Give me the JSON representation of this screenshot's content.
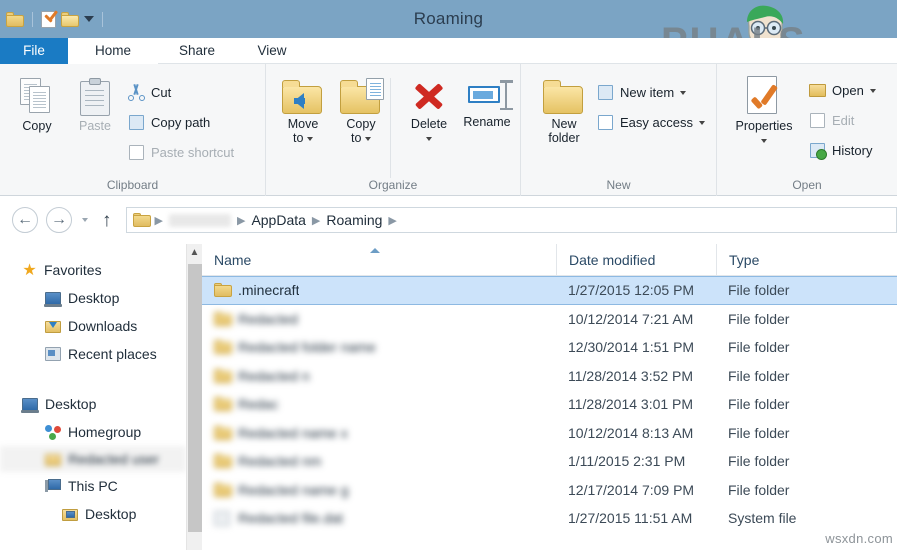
{
  "window": {
    "title": "Roaming",
    "quick_access": [
      "folder-icon",
      "properties-icon",
      "new-folder-icon",
      "customize-caret-icon"
    ]
  },
  "tabs": [
    {
      "label": "File",
      "state": "file"
    },
    {
      "label": "Home",
      "state": "active"
    },
    {
      "label": "Share",
      "state": "normal"
    },
    {
      "label": "View",
      "state": "normal"
    }
  ],
  "ribbon": {
    "groups": [
      {
        "name": "Clipboard",
        "label": "Clipboard",
        "big_buttons": [
          {
            "label": "Copy",
            "icon": "copy-icon",
            "disabled": false
          },
          {
            "label": "Paste",
            "icon": "paste-icon",
            "disabled": true
          }
        ],
        "small_buttons": [
          {
            "label": "Cut",
            "icon": "scissors-icon",
            "disabled": false
          },
          {
            "label": "Copy path",
            "icon": "copy-path-icon",
            "disabled": false
          },
          {
            "label": "Paste shortcut",
            "icon": "paste-shortcut-icon",
            "disabled": true
          }
        ]
      },
      {
        "name": "Organize",
        "label": "Organize",
        "big_buttons": [
          {
            "label": "Move\nto",
            "label_line1": "Move",
            "label_line2": "to",
            "icon": "move-to-icon",
            "caret": true
          },
          {
            "label": "Copy\nto",
            "label_line1": "Copy",
            "label_line2": "to",
            "icon": "copy-to-icon",
            "caret": true
          },
          {
            "label": "Delete",
            "icon": "delete-icon",
            "caret": true
          },
          {
            "label": "Rename",
            "icon": "rename-icon",
            "caret": false
          }
        ]
      },
      {
        "name": "New",
        "label": "New",
        "big_buttons": [
          {
            "label_line1": "New",
            "label_line2": "folder",
            "icon": "new-folder-icon"
          }
        ],
        "small_buttons": [
          {
            "label": "New item",
            "icon": "new-item-icon",
            "caret": true
          },
          {
            "label": "Easy access",
            "icon": "easy-access-icon",
            "caret": true
          }
        ]
      },
      {
        "name": "Open",
        "label": "Open",
        "big_buttons": [
          {
            "label": "Properties",
            "icon": "properties-icon",
            "caret": true
          }
        ],
        "small_buttons": [
          {
            "label": "Open",
            "icon": "open-icon",
            "caret": true,
            "disabled": false
          },
          {
            "label": "Edit",
            "icon": "edit-icon",
            "caret": false,
            "disabled": true
          },
          {
            "label": "History",
            "icon": "history-icon",
            "caret": false,
            "disabled": false
          }
        ]
      }
    ]
  },
  "address_bar": {
    "back_icon": "back-arrow-icon",
    "forward_icon": "forward-arrow-icon",
    "recent_caret_icon": "history-dropdown-icon",
    "up_icon": "up-arrow-icon",
    "breadcrumbs": [
      {
        "label": "",
        "redacted": true,
        "width": 62
      },
      {
        "label": "AppData",
        "redacted": false
      },
      {
        "label": "Roaming",
        "redacted": false
      }
    ]
  },
  "nav_pane": {
    "items": [
      {
        "label": "Favorites",
        "icon": "star-icon",
        "level": 0,
        "blurred": false
      },
      {
        "label": "Desktop",
        "icon": "monitor-icon",
        "level": 1,
        "blurred": false
      },
      {
        "label": "Downloads",
        "icon": "downloads-folder-icon",
        "level": 1,
        "blurred": false
      },
      {
        "label": "Recent places",
        "icon": "recent-places-icon",
        "level": 1,
        "blurred": false
      },
      {
        "label": "",
        "icon": "spacer",
        "level": 0,
        "blurred": false,
        "spacer": true
      },
      {
        "label": "Desktop",
        "icon": "monitor-icon",
        "level": 0,
        "blurred": false
      },
      {
        "label": "Homegroup",
        "icon": "homegroup-icon",
        "level": 1,
        "blurred": false
      },
      {
        "label": "Redacted user",
        "icon": "user-icon",
        "level": 1,
        "blurred": true
      },
      {
        "label": "This PC",
        "icon": "this-pc-icon",
        "level": 1,
        "blurred": false
      },
      {
        "label": "Desktop",
        "icon": "desktop-folder-icon",
        "level": 2,
        "blurred": false
      }
    ],
    "scrollbar": {
      "up_arrow": "scroll-up-icon"
    }
  },
  "file_list": {
    "columns": [
      {
        "label": "Name",
        "sorted": true,
        "sort_direction": "asc"
      },
      {
        "label": "Date modified",
        "sorted": false
      },
      {
        "label": "Type",
        "sorted": false
      }
    ],
    "rows": [
      {
        "name": ".minecraft",
        "date": "1/27/2015 12:05 PM",
        "type": "File folder",
        "selected": true,
        "blurred": false,
        "icon": "folder-icon"
      },
      {
        "name": "Redacted",
        "date": "10/12/2014 7:21 AM",
        "type": "File folder",
        "selected": false,
        "blurred": true,
        "icon": "folder-icon"
      },
      {
        "name": "Redacted folder name",
        "date": "12/30/2014 1:51 PM",
        "type": "File folder",
        "selected": false,
        "blurred": true,
        "icon": "folder-icon"
      },
      {
        "name": "Redacted n",
        "date": "11/28/2014 3:52 PM",
        "type": "File folder",
        "selected": false,
        "blurred": true,
        "icon": "folder-icon"
      },
      {
        "name": "Redac",
        "date": "11/28/2014 3:01 PM",
        "type": "File folder",
        "selected": false,
        "blurred": true,
        "icon": "folder-icon"
      },
      {
        "name": "Redacted name x",
        "date": "10/12/2014 8:13 AM",
        "type": "File folder",
        "selected": false,
        "blurred": true,
        "icon": "folder-icon"
      },
      {
        "name": "Redacted nm",
        "date": "1/11/2015 2:31 PM",
        "type": "File folder",
        "selected": false,
        "blurred": true,
        "icon": "folder-icon"
      },
      {
        "name": "Redacted name g",
        "date": "12/17/2014 7:09 PM",
        "type": "File folder",
        "selected": false,
        "blurred": true,
        "icon": "folder-icon"
      },
      {
        "name": "Redacted file.dat",
        "date": "1/27/2015 11:51 AM",
        "type": "System file",
        "selected": false,
        "blurred": true,
        "icon": "system-file-icon"
      }
    ]
  },
  "watermarks": {
    "brand": "PUALS",
    "brand_full": "APPUALS",
    "site": "wsxdn.com"
  },
  "colors": {
    "titlebar": "#7ba4c4",
    "file_tab": "#1a7bc4",
    "selection": "#cce3fa",
    "selection_border": "#8db9e2",
    "ribbon_bg": "#f6f7f8",
    "column_header_text": "#2b4a66"
  }
}
